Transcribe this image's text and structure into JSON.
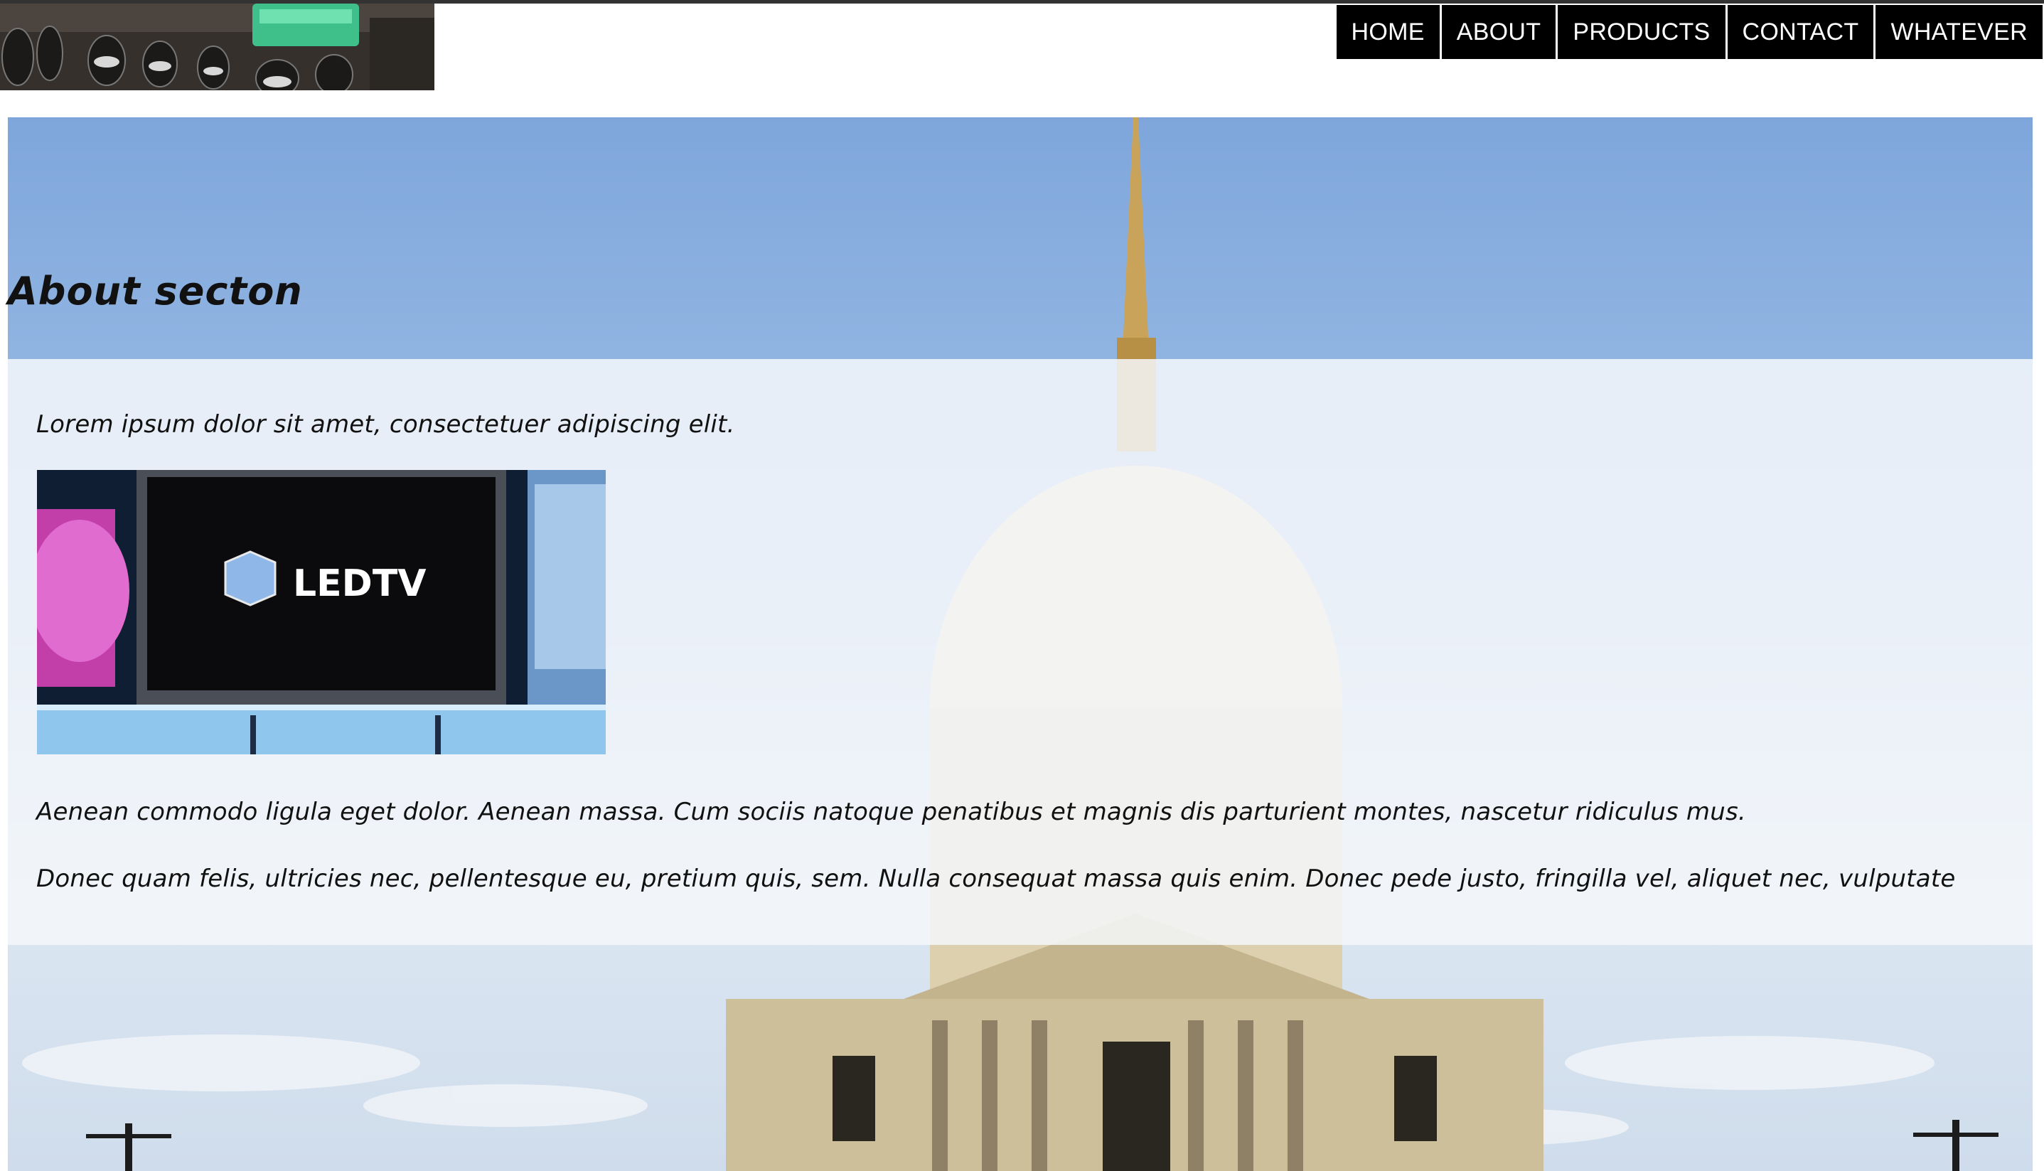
{
  "nav": {
    "items": [
      {
        "label": "HOME"
      },
      {
        "label": "ABOUT"
      },
      {
        "label": "PRODUCTS"
      },
      {
        "label": "CONTACT"
      },
      {
        "label": "WHATEVER"
      }
    ]
  },
  "about": {
    "title": "About secton",
    "intro": "Lorem ipsum dolor sit amet, consectetuer adipiscing elit.",
    "image_text": "LEDTV",
    "paragraph_1": "Aenean commodo ligula eget dolor. Aenean massa. Cum sociis natoque penatibus et magnis dis parturient montes, nascetur ridiculus mus.",
    "paragraph_2": "Donec quam felis, ultricies nec, pellentesque eu, pretium quis, sem. Nulla consequat massa quis enim. Donec pede justo, fringilla vel, aliquet nec, vulputate"
  },
  "colors": {
    "nav_bg": "#000000",
    "nav_text": "#ffffff",
    "panel_bg": "rgba(245,247,250,0.86)",
    "sky": "#7fa6dc"
  }
}
